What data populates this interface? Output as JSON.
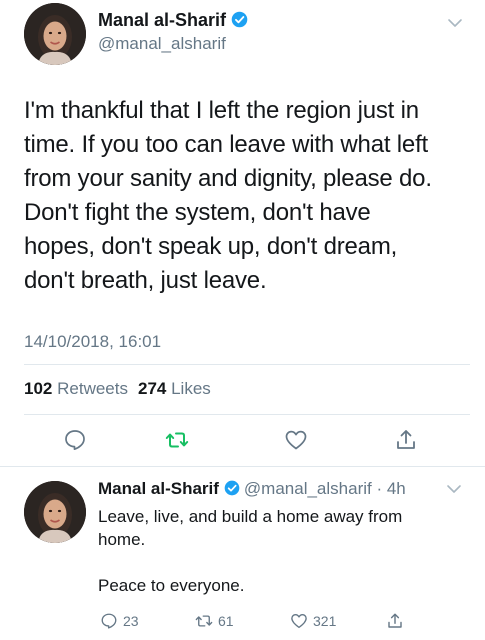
{
  "main_tweet": {
    "author_name": "Manal al-Sharif",
    "handle": "@manal_alsharif",
    "verified": true,
    "text_lines": [
      "I'm thankful that I left the region just in",
      "time. If you too can leave with what left",
      "from your sanity and dignity, please do.",
      "Don't fight the system, don't have",
      "hopes, don't speak up, don't dream,",
      "don't breath, just leave."
    ],
    "timestamp": "14/10/2018, 16:01",
    "retweet_count": "102",
    "retweets_label": "Retweets",
    "like_count": "274",
    "likes_label": "Likes",
    "actions": [
      "reply-icon",
      "retweet-icon",
      "heart-icon",
      "share-icon"
    ]
  },
  "reply_tweet": {
    "author_name": "Manal al-Sharif",
    "handle_time": "@manal_alsharif · 4h",
    "verified": true,
    "text_lines": [
      "Leave, live, and build a home away from",
      "home.",
      "",
      "Peace to everyone."
    ],
    "reply_count": "23",
    "retweet_count": "61",
    "like_count": "321"
  },
  "colors": {
    "text": "#14171a",
    "secondary": "#657786",
    "verified_blue": "#1da1f2",
    "retweet_green": "#17bf63",
    "divider": "#e1e8ed"
  }
}
